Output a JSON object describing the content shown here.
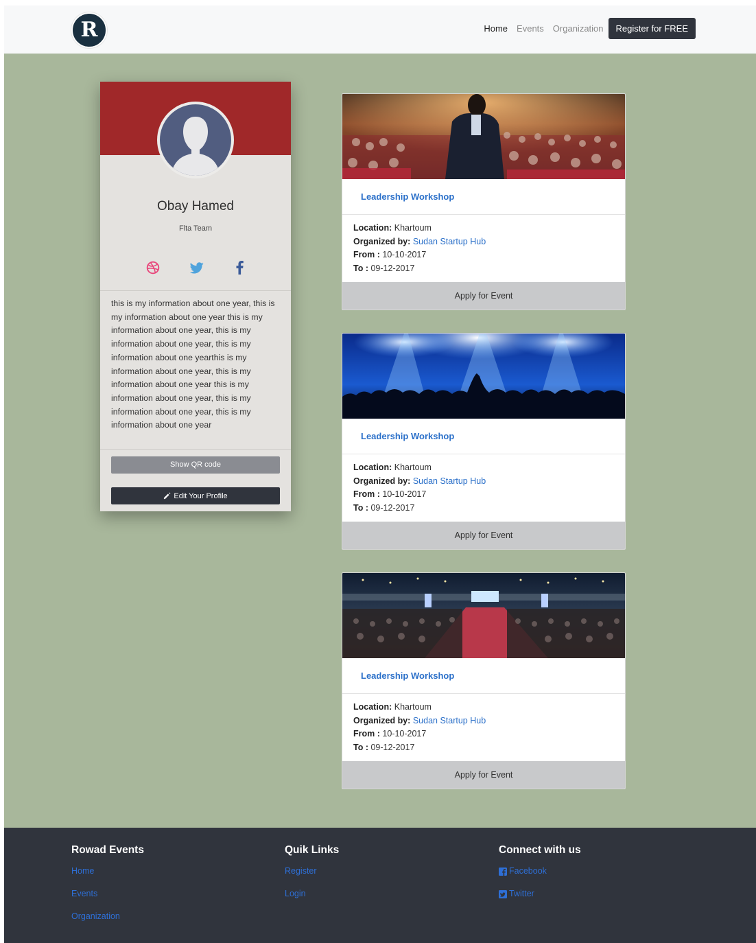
{
  "navbar": {
    "logo_letter": "R",
    "links": [
      "Home",
      "Events",
      "Organization"
    ],
    "register_label": "Register for FREE"
  },
  "profile": {
    "name": "Obay Hamed",
    "team": "Flta Team",
    "bio": "this is my information about one year, this is my information about one year this is my information about one year, this is my information about one year, this is my information about one yearthis is my information about one year, this is my information about one year this is my information about one year, this is my information about one year, this is my information about one year",
    "social_icons": [
      "dribbble-icon",
      "twitter-icon",
      "facebook-icon"
    ],
    "qr_label": "Show QR code",
    "edit_label": "Edit Your Profile"
  },
  "labels": {
    "location": "Location:",
    "organized_by": "Organized by:",
    "from": "From :",
    "to": "To :",
    "apply": "Apply for Event"
  },
  "events": [
    {
      "image": "speaker-conference-photo",
      "title": "Leadership Workshop",
      "location": "Khartoum",
      "organizer": "Sudan Startup Hub",
      "from": "10-10-2017",
      "to": "09-12-2017"
    },
    {
      "image": "concert-crowd-photo",
      "title": "Leadership Workshop",
      "location": "Khartoum",
      "organizer": "Sudan Startup Hub",
      "from": "10-10-2017",
      "to": "09-12-2017"
    },
    {
      "image": "conference-hall-photo",
      "title": "Leadership Workshop",
      "location": "Khartoum",
      "organizer": "Sudan Startup Hub",
      "from": "10-10-2017",
      "to": "09-12-2017"
    }
  ],
  "footer": {
    "col1": {
      "heading": "Rowad Events",
      "links": [
        "Home",
        "Events",
        "Organization"
      ]
    },
    "col2": {
      "heading": "Quik Links",
      "links": [
        "Register",
        "Login"
      ]
    },
    "col3": {
      "heading": "Connect with us",
      "links": [
        "Facebook",
        "Twitter"
      ]
    }
  },
  "colors": {
    "page_bg": "#a8b79b",
    "banner_red": "#a02829",
    "dark": "#30343d",
    "link_blue": "#2b70c9"
  }
}
